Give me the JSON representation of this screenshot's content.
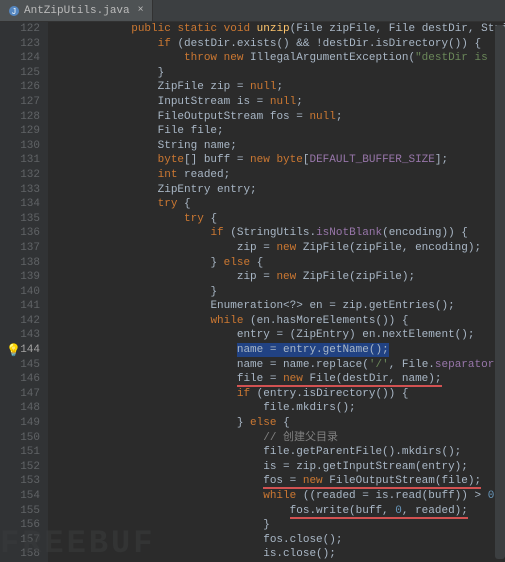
{
  "tab": {
    "filename": "AntZipUtils.java"
  },
  "gutter": {
    "start": 122,
    "end": 158,
    "highlight": 144
  },
  "code": {
    "lines": [
      {
        "n": 122,
        "ind": 3,
        "seg": [
          {
            "t": "public ",
            "c": "kw"
          },
          {
            "t": "static void ",
            "c": "kw"
          },
          {
            "t": "unzip",
            "c": "mth"
          },
          {
            "t": "(File zipFile, File destDir, String encoding) {"
          }
        ]
      },
      {
        "n": 123,
        "ind": 4,
        "seg": [
          {
            "t": "if ",
            "c": "kw"
          },
          {
            "t": "(destDir.exists() && !destDir.isDirectory()) {"
          }
        ]
      },
      {
        "n": 124,
        "ind": 5,
        "seg": [
          {
            "t": "throw new ",
            "c": "kw"
          },
          {
            "t": "IllegalArgumentException("
          },
          {
            "t": "\"destDir is not a directory!\"",
            "c": "str"
          },
          {
            "t": ");"
          }
        ]
      },
      {
        "n": 125,
        "ind": 4,
        "seg": [
          {
            "t": "}"
          }
        ]
      },
      {
        "n": 126,
        "ind": 4,
        "seg": [
          {
            "t": "ZipFile zip = "
          },
          {
            "t": "null",
            "c": "kw"
          },
          {
            "t": ";"
          }
        ]
      },
      {
        "n": 127,
        "ind": 4,
        "seg": [
          {
            "t": "InputStream is = "
          },
          {
            "t": "null",
            "c": "kw"
          },
          {
            "t": ";"
          }
        ]
      },
      {
        "n": 128,
        "ind": 4,
        "seg": [
          {
            "t": "FileOutputStream fos = "
          },
          {
            "t": "null",
            "c": "kw"
          },
          {
            "t": ";"
          }
        ]
      },
      {
        "n": 129,
        "ind": 4,
        "seg": [
          {
            "t": "File file;"
          }
        ]
      },
      {
        "n": 130,
        "ind": 4,
        "seg": [
          {
            "t": "String name;"
          }
        ]
      },
      {
        "n": 131,
        "ind": 4,
        "seg": [
          {
            "t": "byte",
            "c": "kw"
          },
          {
            "t": "[] buff = "
          },
          {
            "t": "new ",
            "c": "kw"
          },
          {
            "t": "byte",
            "c": "kw"
          },
          {
            "t": "["
          },
          {
            "t": "DEFAULT_BUFFER_SIZE",
            "c": "fld"
          },
          {
            "t": "];"
          }
        ]
      },
      {
        "n": 132,
        "ind": 4,
        "seg": [
          {
            "t": "int ",
            "c": "kw"
          },
          {
            "t": "readed;"
          }
        ]
      },
      {
        "n": 133,
        "ind": 4,
        "seg": [
          {
            "t": "ZipEntry entry;"
          }
        ]
      },
      {
        "n": 134,
        "ind": 4,
        "seg": [
          {
            "t": "try ",
            "c": "kw"
          },
          {
            "t": "{"
          }
        ]
      },
      {
        "n": 135,
        "ind": 5,
        "seg": [
          {
            "t": "try ",
            "c": "kw"
          },
          {
            "t": "{"
          }
        ]
      },
      {
        "n": 136,
        "ind": 6,
        "seg": [
          {
            "t": "if ",
            "c": "kw"
          },
          {
            "t": "(StringUtils."
          },
          {
            "t": "isNotBlank",
            "c": "fld"
          },
          {
            "t": "(encoding)) {"
          }
        ]
      },
      {
        "n": 137,
        "ind": 7,
        "seg": [
          {
            "t": "zip = "
          },
          {
            "t": "new ",
            "c": "kw"
          },
          {
            "t": "ZipFile(zipFile, encoding);"
          }
        ]
      },
      {
        "n": 138,
        "ind": 6,
        "seg": [
          {
            "t": "} "
          },
          {
            "t": "else ",
            "c": "kw"
          },
          {
            "t": "{"
          }
        ]
      },
      {
        "n": 139,
        "ind": 7,
        "seg": [
          {
            "t": "zip = "
          },
          {
            "t": "new ",
            "c": "kw"
          },
          {
            "t": "ZipFile(zipFile);"
          }
        ]
      },
      {
        "n": 140,
        "ind": 6,
        "seg": [
          {
            "t": "}"
          }
        ]
      },
      {
        "n": 141,
        "ind": 6,
        "seg": [
          {
            "t": "Enumeration<?> en = zip.getEntries();"
          }
        ]
      },
      {
        "n": 142,
        "ind": 6,
        "seg": [
          {
            "t": "while ",
            "c": "kw"
          },
          {
            "t": "(en.hasMoreElements()) {"
          }
        ]
      },
      {
        "n": 143,
        "ind": 7,
        "seg": [
          {
            "t": "entry = (ZipEntry) en.nextElement();"
          }
        ]
      },
      {
        "n": 144,
        "ind": 7,
        "bulb": true,
        "seg": [
          {
            "t": "name = entry.getName();",
            "c": "",
            "hl": "sel"
          }
        ]
      },
      {
        "n": 145,
        "ind": 7,
        "seg": [
          {
            "t": "name = name.replace("
          },
          {
            "t": "'/'",
            "c": "str"
          },
          {
            "t": ", File."
          },
          {
            "t": "separatorChar",
            "c": "fld"
          },
          {
            "t": ");",
            "hl": "err"
          }
        ]
      },
      {
        "n": 146,
        "ind": 7,
        "seg": [
          {
            "t": "file = ",
            "hl": "err"
          },
          {
            "t": "new ",
            "c": "kw",
            "hl": "err"
          },
          {
            "t": "File(destDir, name);",
            "hl": "err"
          }
        ]
      },
      {
        "n": 147,
        "ind": 7,
        "seg": [
          {
            "t": "if ",
            "c": "kw"
          },
          {
            "t": "(entry.isDirectory()) {"
          }
        ]
      },
      {
        "n": 148,
        "ind": 8,
        "seg": [
          {
            "t": "file.mkdirs();"
          }
        ]
      },
      {
        "n": 149,
        "ind": 7,
        "seg": [
          {
            "t": "} "
          },
          {
            "t": "else ",
            "c": "kw"
          },
          {
            "t": "{"
          }
        ]
      },
      {
        "n": 150,
        "ind": 8,
        "seg": [
          {
            "t": "// 创建父目录",
            "c": "com"
          }
        ]
      },
      {
        "n": 151,
        "ind": 8,
        "seg": [
          {
            "t": "file.getParentFile().mkdirs();"
          }
        ]
      },
      {
        "n": 152,
        "ind": 8,
        "seg": [
          {
            "t": "is = zip.getInputStream(entry);"
          }
        ]
      },
      {
        "n": 153,
        "ind": 8,
        "seg": [
          {
            "t": "fos = ",
            "hl": "err"
          },
          {
            "t": "new ",
            "c": "kw",
            "hl": "err"
          },
          {
            "t": "FileOutputStream(file);",
            "hl": "err"
          }
        ]
      },
      {
        "n": 154,
        "ind": 8,
        "seg": [
          {
            "t": "while ",
            "c": "kw"
          },
          {
            "t": "((readed = is.read(buff)) > "
          },
          {
            "t": "0",
            "c": "num"
          },
          {
            "t": ") {"
          }
        ]
      },
      {
        "n": 155,
        "ind": 9,
        "seg": [
          {
            "t": "fos.write(buff, ",
            "hl": "err"
          },
          {
            "t": "0",
            "c": "num",
            "hl": "err"
          },
          {
            "t": ", readed);",
            "hl": "err"
          }
        ]
      },
      {
        "n": 156,
        "ind": 8,
        "seg": [
          {
            "t": "}"
          }
        ]
      },
      {
        "n": 157,
        "ind": 8,
        "seg": [
          {
            "t": "fos.close();"
          }
        ]
      },
      {
        "n": 158,
        "ind": 8,
        "seg": [
          {
            "t": "is.close();"
          }
        ]
      }
    ]
  },
  "watermark": "FREEBUF"
}
